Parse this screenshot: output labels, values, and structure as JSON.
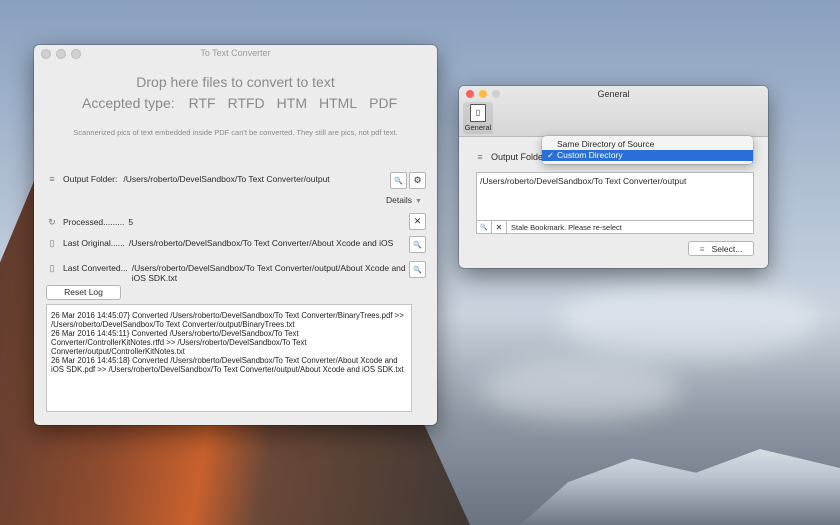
{
  "main_window": {
    "title": "To Text Converter",
    "drop_title": "Drop here files to convert to text",
    "accepted_label": "Accepted type:",
    "types": [
      "RTF",
      "RTFD",
      "HTM",
      "HTML",
      "PDF"
    ],
    "note": "Scannerized pics of text embedded inside PDF can't be converted. They still are pics, not pdf text.",
    "output_folder_label": "Output Folder:",
    "output_folder_path": "/Users/roberto/DevelSandbox/To Text Converter/output",
    "details_label": "Details",
    "processed_label": "Processed.........",
    "processed_count": "5",
    "last_original_label": "Last Original......",
    "last_original_path": "/Users/roberto/DevelSandbox/To Text Converter/About Xcode and iOS",
    "last_converted_label": "Last Converted...",
    "last_converted_path": "/Users/roberto/DevelSandbox/To Text Converter/output/About Xcode and iOS SDK.txt",
    "reset_label": "Reset Log",
    "log_lines": [
      "26 Mar 2016 14:45:07} Converted /Users/roberto/DevelSandbox/To Text Converter/BinaryTrees.pdf  >>  /Users/roberto/DevelSandbox/To Text Converter/output/BinaryTrees.txt",
      "26 Mar 2016 14:45:11} Converted /Users/roberto/DevelSandbox/To Text Converter/ControllerKitNotes.rtfd  >>  /Users/roberto/DevelSandbox/To Text Converter/output/ControllerKitNotes.txt",
      "26 Mar 2016 14:45:18} Converted /Users/roberto/DevelSandbox/To Text Converter/About Xcode and iOS SDK.pdf  >>  /Users/roberto/DevelSandbox/To Text Converter/output/About Xcode and iOS SDK.txt"
    ]
  },
  "general_window": {
    "title": "General",
    "tab_label": "General",
    "output_folder_label": "Output Folder",
    "menu_options": [
      "Same Directory of Source",
      "Custom Directory"
    ],
    "menu_check": "✓",
    "path": "/Users/roberto/DevelSandbox/To Text Converter/output",
    "status": "Stale Bookmark. Please re-select",
    "select_label": "Select..."
  },
  "icons": {
    "list": "≡",
    "search": "🔍",
    "gear": "⚙",
    "close": "✕",
    "refresh": "↻",
    "doc": "▯",
    "triangle": "▼"
  },
  "colors": {
    "accent": "#2a6fd8",
    "close": "#fc605c",
    "minimize": "#fdbc40",
    "zoom": "#34c84a"
  }
}
